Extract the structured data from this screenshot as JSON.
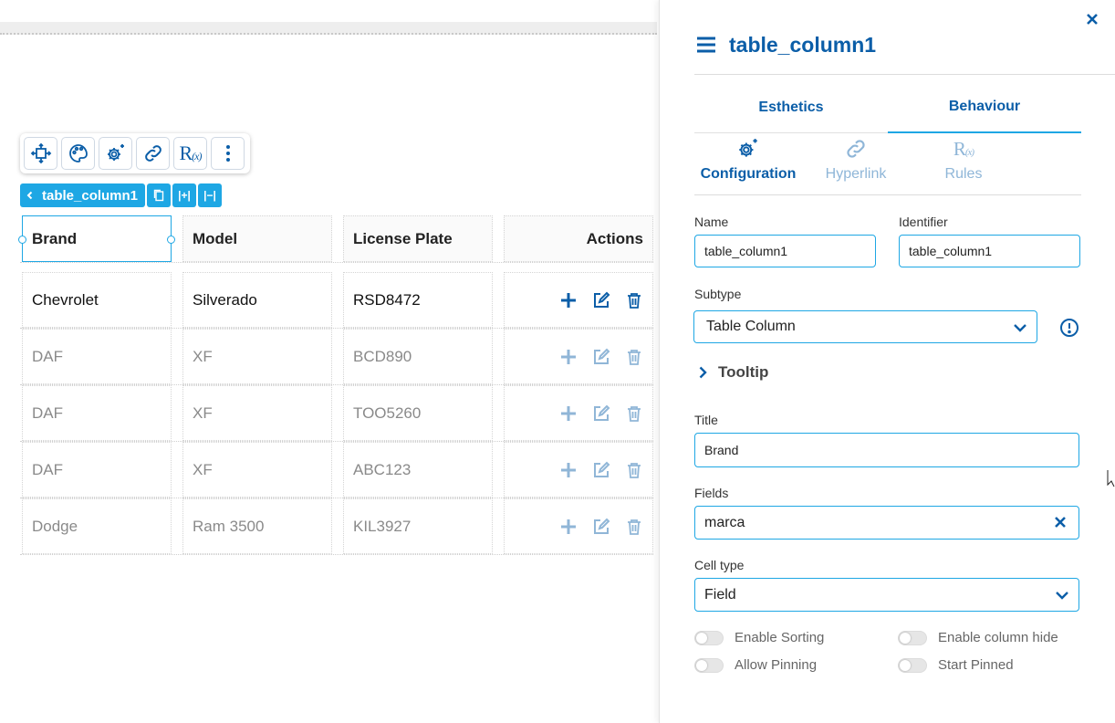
{
  "toolbar": {
    "icons": [
      "move-icon",
      "palette-icon",
      "gear-sparkle-icon",
      "link-icon",
      "rules-icon",
      "more-vertical-icon"
    ],
    "rules_glyph": "R",
    "rules_sub": "(x)"
  },
  "breadcrumb": {
    "label": "table_column1",
    "btn_insert_left": "|+|",
    "btn_remove": "|−|"
  },
  "table": {
    "headers": [
      "Brand",
      "Model",
      "License Plate",
      "Actions"
    ],
    "rows": [
      [
        "Chevrolet",
        "Silverado",
        "RSD8472"
      ],
      [
        "DAF",
        "XF",
        "BCD890"
      ],
      [
        "DAF",
        "XF",
        "TOO5260"
      ],
      [
        "DAF",
        "XF",
        "ABC123"
      ],
      [
        "Dodge",
        "Ram 3500",
        "KIL3927"
      ]
    ]
  },
  "panel": {
    "title": "table_column1",
    "tabs": [
      "Esthetics",
      "Behaviour"
    ],
    "subtabs": [
      "Configuration",
      "Hyperlink",
      "Rules"
    ],
    "subtab_rules_glyph": "R",
    "subtab_rules_sub": "(x)",
    "name_label": "Name",
    "name_value": "table_column1",
    "identifier_label": "Identifier",
    "identifier_value": "table_column1",
    "subtype_label": "Subtype",
    "subtype_value": "Table Column",
    "tooltip_label": "Tooltip",
    "title_label": "Title",
    "title_value": "Brand",
    "fields_label": "Fields",
    "fields_value": "marca",
    "celltype_label": "Cell type",
    "celltype_value": "Field",
    "toggles": [
      "Enable Sorting",
      "Enable column hide",
      "Allow Pinning",
      "Start Pinned"
    ]
  },
  "colors": {
    "accent": "#1ea7e4",
    "primary": "#0b5ea8"
  }
}
